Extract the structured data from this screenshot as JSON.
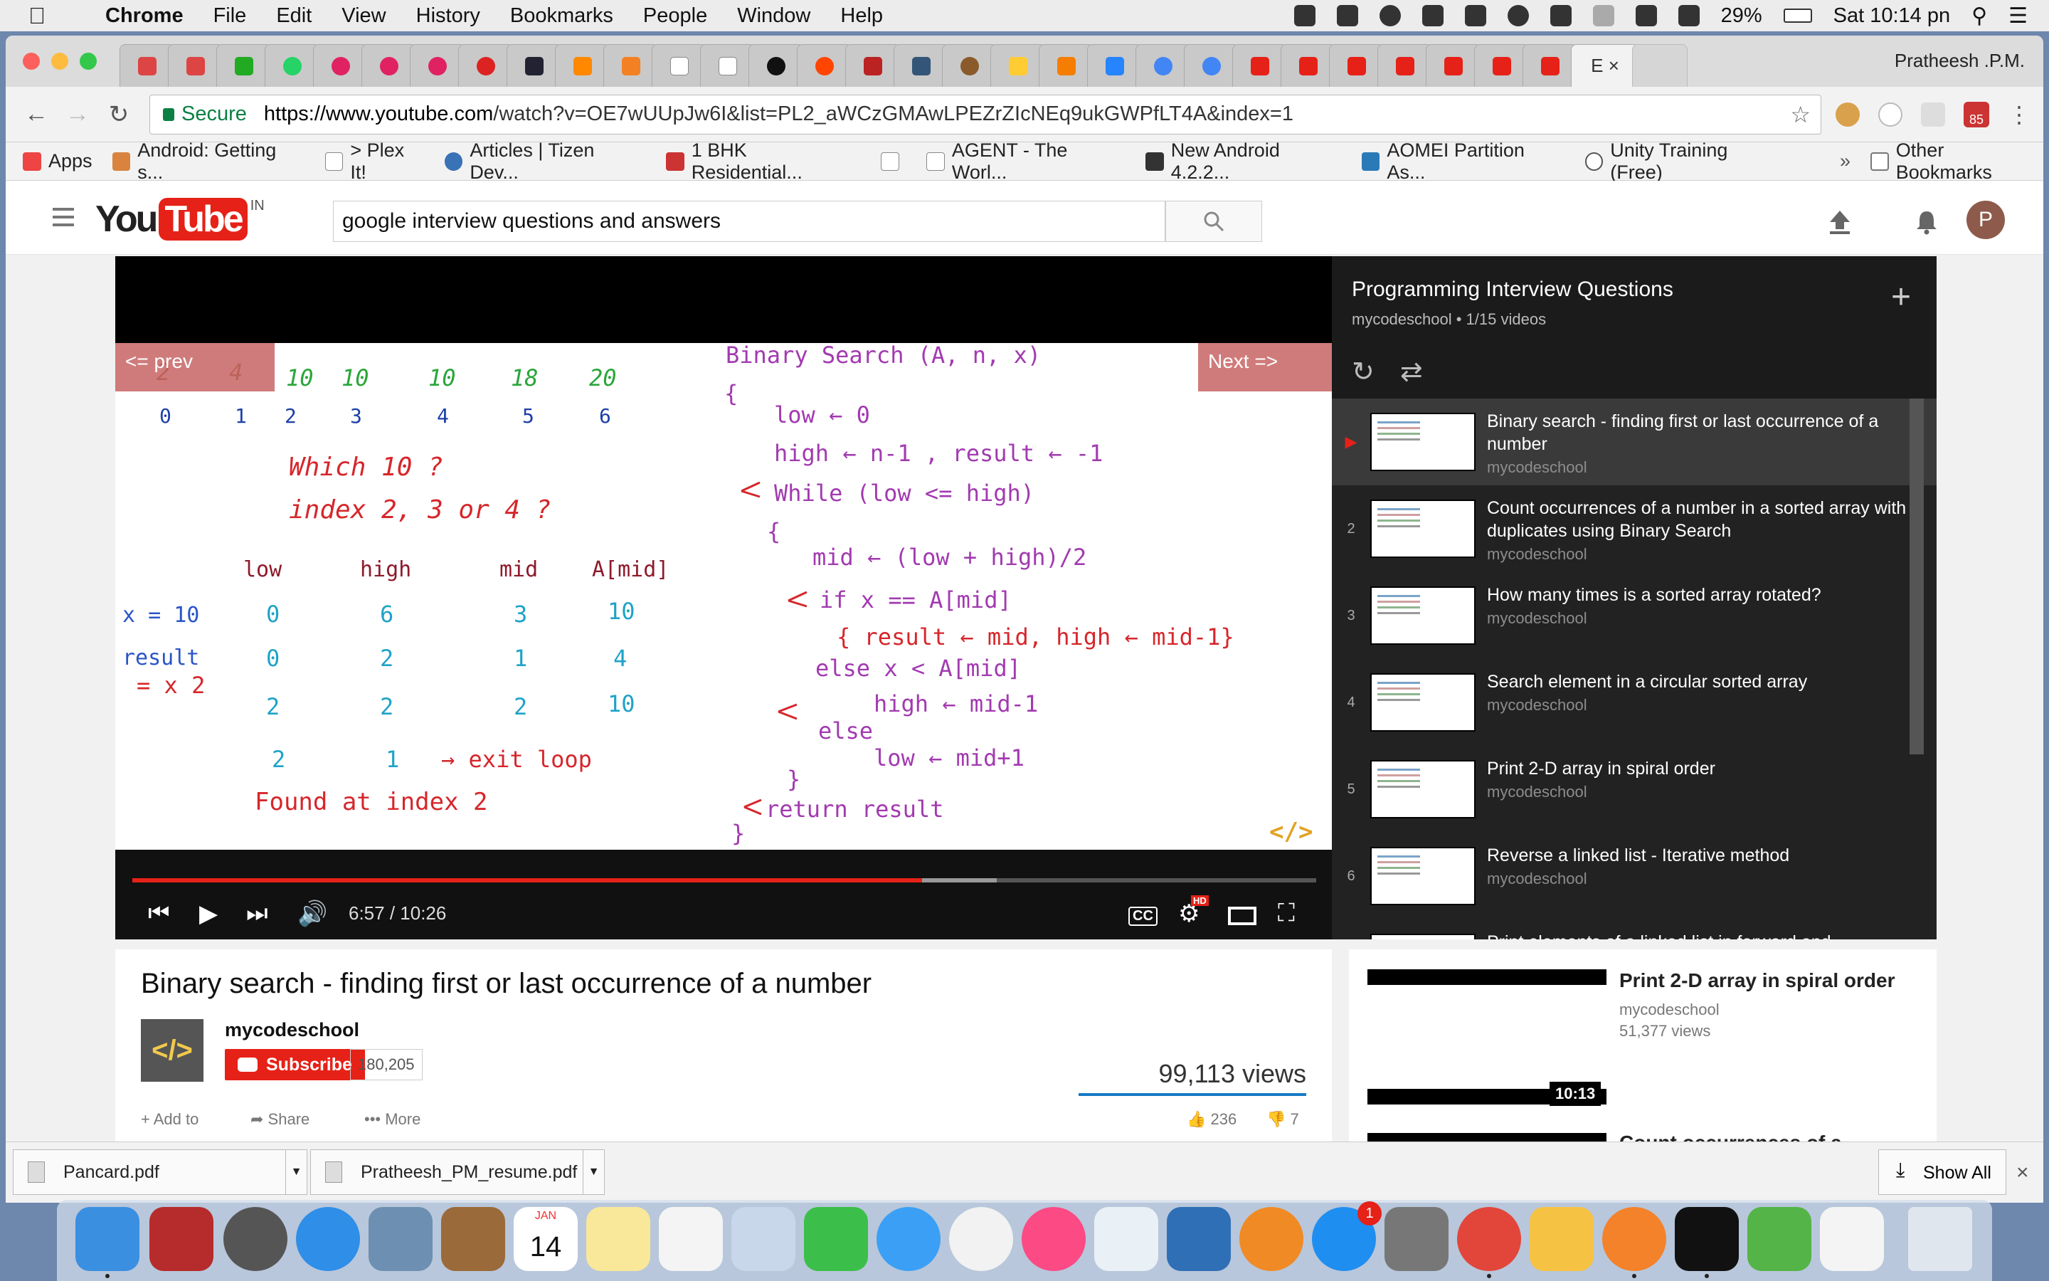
{
  "menubar": {
    "app_name": "Chrome",
    "menus": [
      "File",
      "Edit",
      "View",
      "History",
      "Bookmarks",
      "People",
      "Window",
      "Help"
    ],
    "battery": "29%",
    "clock": "Sat 10:14 pn"
  },
  "browser": {
    "active_tab_label": "E",
    "profile_name": "Pratheesh .P.M.",
    "url_secure_label": "Secure",
    "url_host": "https://www.youtube.com",
    "url_path": "/watch?v=OE7wUUpJw6I&list=PL2_aWCzGMAwLPEZrZIcNEq9ukGWPfLT4A&index=1",
    "toolbar_badge": "85",
    "bookmarks": [
      "Apps",
      "Android: Getting s...",
      "> Plex It!",
      "Articles | Tizen Dev...",
      "1 BHK Residential...",
      "",
      "AGENT - The Worl...",
      "New Android 4.2.2...",
      "AOMEI Partition As...",
      "Unity Training (Free)"
    ],
    "bookmarks_overflow": "»",
    "other_bookmarks": "Other Bookmarks"
  },
  "youtube": {
    "logo_you": "You",
    "logo_tube": "Tube",
    "logo_country": "IN",
    "search_query": "google interview questions and answers",
    "avatar_letter": "P"
  },
  "player": {
    "prev_label": "<= prev",
    "next_label": "Next =>",
    "time": "6:57 / 10:26",
    "progress_fraction": 0.667,
    "buffered_fraction": 0.73,
    "hd_badge": "HD",
    "cc_label": "CC",
    "whiteboard": {
      "array_values": [
        "2",
        "4",
        "10",
        "10",
        "10",
        "18",
        "20"
      ],
      "array_indices": [
        "0",
        "1",
        "2",
        "3",
        "4",
        "5",
        "6"
      ],
      "question_1": "Which  10 ?",
      "question_2": "index  2, 3 or  4 ?",
      "table_headers": [
        "low",
        "high",
        "mid",
        "A[mid]"
      ],
      "x_label": "x = 10",
      "result_label": "result",
      "result_value": "= x 2",
      "rows": [
        [
          "0",
          "6",
          "3",
          "10"
        ],
        [
          "0",
          "2",
          "1",
          "4"
        ],
        [
          "2",
          "2",
          "2",
          "10"
        ],
        [
          "2",
          "1",
          "→ exit loop",
          ""
        ]
      ],
      "found": "Found  at  index  2",
      "code": [
        "Binary Search (A, n, x)",
        "{",
        "low ← 0",
        "high ← n-1 , result ← -1",
        "While (low <= high)",
        "{",
        "mid ← (low + high)/2",
        "if  x == A[mid]",
        "{ result ← mid, high ← mid-1}",
        "else  x < A[mid]",
        "high ← mid-1",
        "else",
        "low ← mid+1",
        "}",
        "return  result",
        "}"
      ],
      "logo": "</>"
    }
  },
  "playlist": {
    "title": "Programming Interview Questions",
    "subtitle": "mycodeschool • 1/15 videos",
    "items": [
      {
        "index": "▶",
        "title": "Binary search - finding first or last occurrence of a number",
        "channel": "mycodeschool"
      },
      {
        "index": "2",
        "title": "Count occurrences of a number in a sorted array with duplicates using Binary Search",
        "channel": "mycodeschool"
      },
      {
        "index": "3",
        "title": "How many times is a sorted array rotated?",
        "channel": "mycodeschool"
      },
      {
        "index": "4",
        "title": "Search element in a circular sorted array",
        "channel": "mycodeschool"
      },
      {
        "index": "5",
        "title": "Print 2-D array in spiral order",
        "channel": "mycodeschool"
      },
      {
        "index": "6",
        "title": "Reverse a linked list - Iterative method",
        "channel": "mycodeschool"
      },
      {
        "index": "",
        "title": "Print elements of a linked list in forward and",
        "channel": ""
      }
    ]
  },
  "video_info": {
    "title": "Binary search - finding first or last occurrence of a number",
    "channel": "mycodeschool",
    "channel_logo": "</>",
    "subscribe": "Subscribe",
    "subscriber_count": "180,205",
    "views": "99,113 views",
    "add_to": "Add to",
    "share": "Share",
    "more": "More",
    "likes": "236",
    "dislikes": "7"
  },
  "related": {
    "title": "Print 2-D array in spiral order",
    "channel": "mycodeschool",
    "views": "51,377 views",
    "duration": "10:13",
    "next_title": "Count occurrences of a"
  },
  "downloads": {
    "files": [
      "Pancard.pdf",
      "Pratheesh_PM_resume.pdf"
    ],
    "show_all": "Show All",
    "close": "×"
  },
  "dock": {
    "calendar_month": "JAN",
    "calendar_day": "14",
    "appstore_badge": "1"
  }
}
